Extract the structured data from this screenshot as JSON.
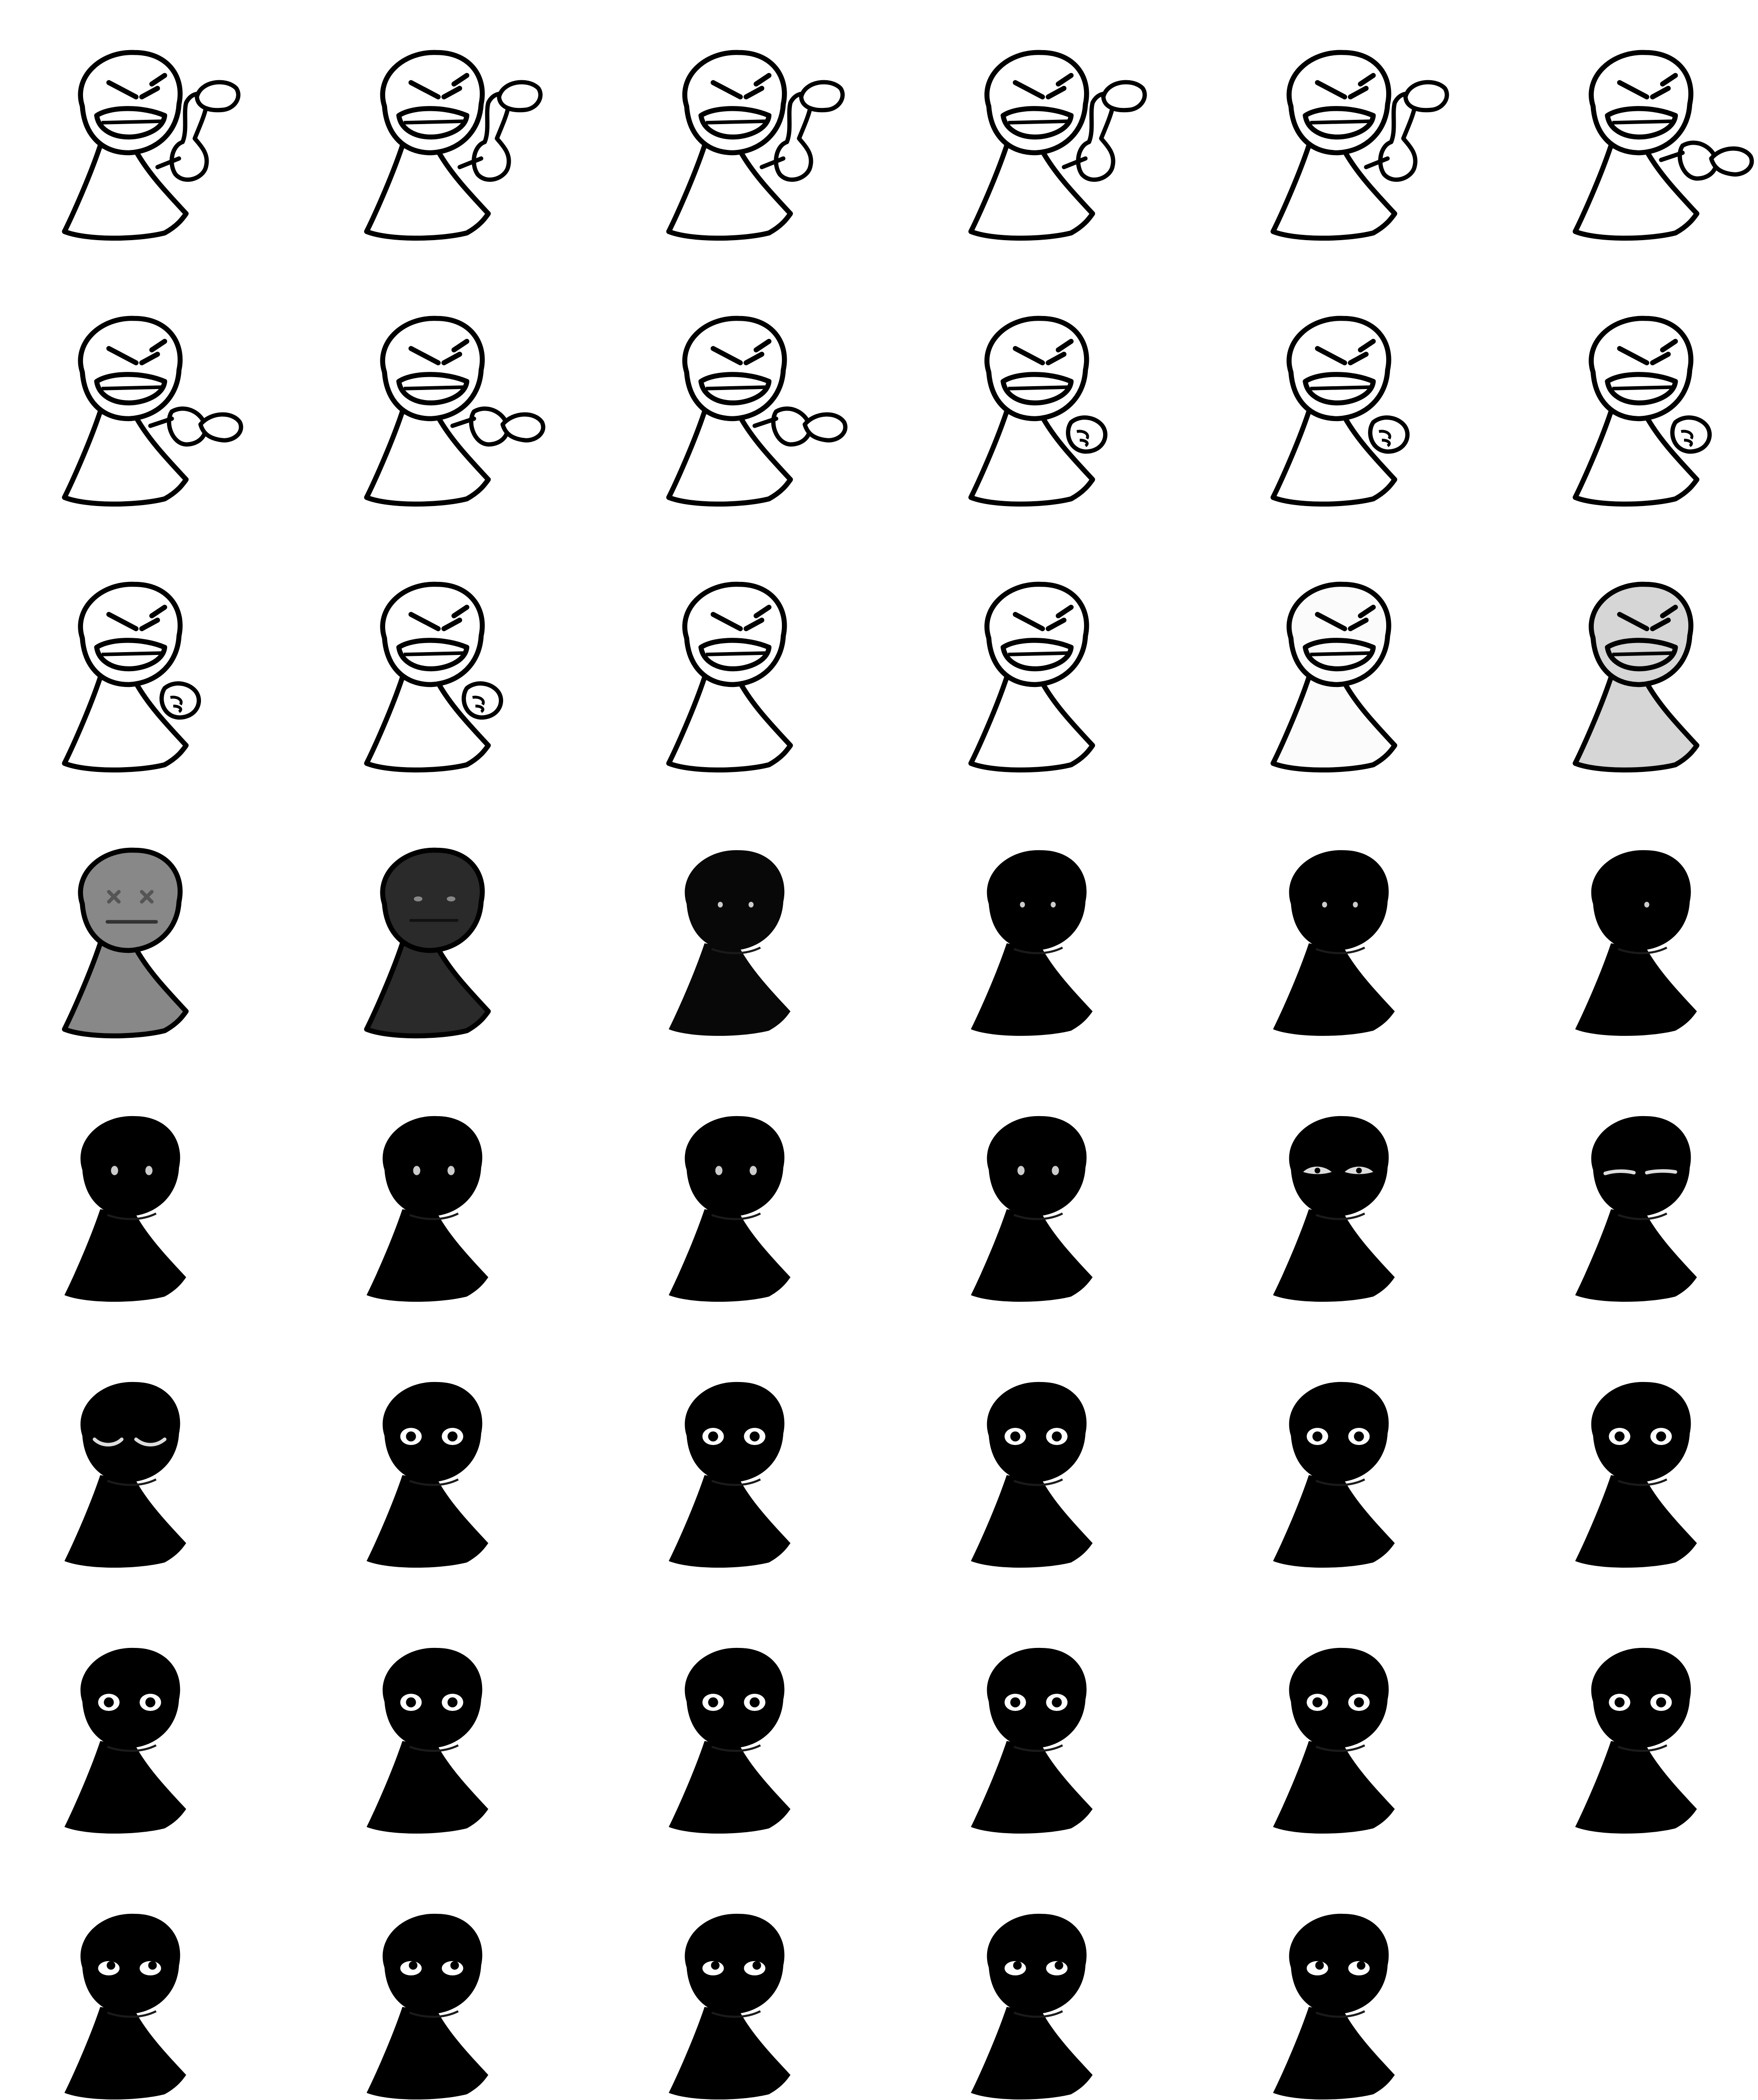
{
  "sprite_sheet": {
    "columns": 6,
    "rows": 8,
    "frame_count": 47,
    "colors": {
      "background": "#ffffff",
      "outline": "#000000",
      "eye_white": "#ffffff",
      "eye_grey": "#c8c8c8"
    },
    "frames": [
      {
        "index": 0,
        "fill": "#ffffff",
        "outline": true,
        "face": "angry",
        "hand": "thumb-up"
      },
      {
        "index": 1,
        "fill": "#ffffff",
        "outline": true,
        "face": "angry",
        "hand": "thumb-up"
      },
      {
        "index": 2,
        "fill": "#ffffff",
        "outline": true,
        "face": "angry",
        "hand": "thumb-up"
      },
      {
        "index": 3,
        "fill": "#ffffff",
        "outline": true,
        "face": "angry",
        "hand": "thumb-up"
      },
      {
        "index": 4,
        "fill": "#ffffff",
        "outline": true,
        "face": "angry",
        "hand": "thumb-up"
      },
      {
        "index": 5,
        "fill": "#ffffff",
        "outline": true,
        "face": "angry",
        "hand": "thumb-down"
      },
      {
        "index": 6,
        "fill": "#ffffff",
        "outline": true,
        "face": "angry",
        "hand": "thumb-down"
      },
      {
        "index": 7,
        "fill": "#ffffff",
        "outline": true,
        "face": "angry",
        "hand": "thumb-down"
      },
      {
        "index": 8,
        "fill": "#ffffff",
        "outline": true,
        "face": "angry",
        "hand": "thumb-down"
      },
      {
        "index": 9,
        "fill": "#ffffff",
        "outline": true,
        "face": "angry",
        "hand": "fist"
      },
      {
        "index": 10,
        "fill": "#ffffff",
        "outline": true,
        "face": "angry",
        "hand": "fist"
      },
      {
        "index": 11,
        "fill": "#ffffff",
        "outline": true,
        "face": "angry",
        "hand": "fist"
      },
      {
        "index": 12,
        "fill": "#ffffff",
        "outline": true,
        "face": "angry",
        "hand": "fist"
      },
      {
        "index": 13,
        "fill": "#ffffff",
        "outline": true,
        "face": "angry",
        "hand": "fist"
      },
      {
        "index": 14,
        "fill": "#ffffff",
        "outline": true,
        "face": "angry",
        "hand": "none"
      },
      {
        "index": 15,
        "fill": "#ffffff",
        "outline": true,
        "face": "angry",
        "hand": "none"
      },
      {
        "index": 16,
        "fill": "#fbfbfb",
        "outline": true,
        "face": "angry",
        "hand": "none"
      },
      {
        "index": 17,
        "fill": "#d6d6d6",
        "outline": true,
        "face": "angry",
        "hand": "none"
      },
      {
        "index": 18,
        "fill": "#888888",
        "outline": true,
        "face": "x-eyes",
        "hand": "none"
      },
      {
        "index": 19,
        "fill": "#2a2a2a",
        "outline": true,
        "face": "dim-eyes",
        "hand": "none"
      },
      {
        "index": 20,
        "fill": "#080808",
        "outline": false,
        "face": "tiny-dots",
        "hand": "none"
      },
      {
        "index": 21,
        "fill": "#000000",
        "outline": false,
        "face": "tiny-dots",
        "hand": "none"
      },
      {
        "index": 22,
        "fill": "#000000",
        "outline": false,
        "face": "tiny-dots",
        "hand": "none"
      },
      {
        "index": 23,
        "fill": "#000000",
        "outline": false,
        "face": "single-dot",
        "hand": "none"
      },
      {
        "index": 24,
        "fill": "#000000",
        "outline": false,
        "face": "dots",
        "hand": "none"
      },
      {
        "index": 25,
        "fill": "#000000",
        "outline": false,
        "face": "dots",
        "hand": "none"
      },
      {
        "index": 26,
        "fill": "#000000",
        "outline": false,
        "face": "dots",
        "hand": "none"
      },
      {
        "index": 27,
        "fill": "#000000",
        "outline": false,
        "face": "dots",
        "hand": "none"
      },
      {
        "index": 28,
        "fill": "#000000",
        "outline": false,
        "face": "half-lids",
        "hand": "none"
      },
      {
        "index": 29,
        "fill": "#000000",
        "outline": false,
        "face": "closed-lines",
        "hand": "none"
      },
      {
        "index": 30,
        "fill": "#000000",
        "outline": false,
        "face": "closed-arcs",
        "hand": "none"
      },
      {
        "index": 31,
        "fill": "#000000",
        "outline": false,
        "face": "open-eyes",
        "hand": "none"
      },
      {
        "index": 32,
        "fill": "#000000",
        "outline": false,
        "face": "open-eyes",
        "hand": "none"
      },
      {
        "index": 33,
        "fill": "#000000",
        "outline": false,
        "face": "open-eyes",
        "hand": "none"
      },
      {
        "index": 34,
        "fill": "#000000",
        "outline": false,
        "face": "open-eyes",
        "hand": "none"
      },
      {
        "index": 35,
        "fill": "#000000",
        "outline": false,
        "face": "open-eyes",
        "hand": "none"
      },
      {
        "index": 36,
        "fill": "#000000",
        "outline": false,
        "face": "open-eyes",
        "hand": "none"
      },
      {
        "index": 37,
        "fill": "#000000",
        "outline": false,
        "face": "open-eyes",
        "hand": "none"
      },
      {
        "index": 38,
        "fill": "#000000",
        "outline": false,
        "face": "open-eyes",
        "hand": "none"
      },
      {
        "index": 39,
        "fill": "#000000",
        "outline": false,
        "face": "open-eyes",
        "hand": "none"
      },
      {
        "index": 40,
        "fill": "#000000",
        "outline": false,
        "face": "open-eyes",
        "hand": "none"
      },
      {
        "index": 41,
        "fill": "#000000",
        "outline": false,
        "face": "open-eyes",
        "hand": "none"
      },
      {
        "index": 42,
        "fill": "#000000",
        "outline": false,
        "face": "looking-up",
        "hand": "none"
      },
      {
        "index": 43,
        "fill": "#000000",
        "outline": false,
        "face": "looking-up",
        "hand": "none"
      },
      {
        "index": 44,
        "fill": "#000000",
        "outline": false,
        "face": "looking-up",
        "hand": "none"
      },
      {
        "index": 45,
        "fill": "#000000",
        "outline": false,
        "face": "looking-up",
        "hand": "none"
      },
      {
        "index": 46,
        "fill": "#000000",
        "outline": false,
        "face": "looking-up",
        "hand": "none"
      }
    ]
  }
}
